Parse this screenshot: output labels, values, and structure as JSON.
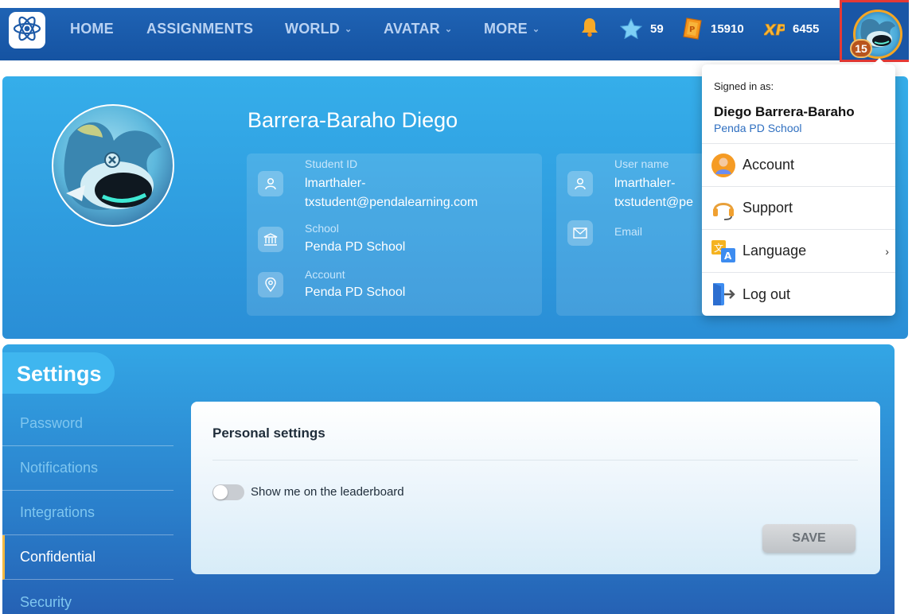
{
  "nav": {
    "items": [
      {
        "label": "HOME"
      },
      {
        "label": "ASSIGNMENTS"
      },
      {
        "label": "WORLD"
      },
      {
        "label": "AVATAR"
      },
      {
        "label": "MORE"
      }
    ],
    "stats": {
      "stars": "59",
      "coins": "15910",
      "xp": "6455"
    },
    "avatar_level": "15"
  },
  "profile": {
    "name": "Barrera-Baraho Diego",
    "student_id_label": "Student ID",
    "student_id_value_1": "lmarthaler-",
    "student_id_value_2": "txstudent@pendalearning.com",
    "school_label": "School",
    "school_value": "Penda PD School",
    "account_label": "Account",
    "account_value": "Penda PD School",
    "username_label": "User name",
    "username_value_1": "lmarthaler-",
    "username_value_2": "txstudent@pe",
    "email_label": "Email"
  },
  "settings": {
    "title": "Settings",
    "menu": [
      {
        "label": "Password"
      },
      {
        "label": "Notifications"
      },
      {
        "label": "Integrations"
      },
      {
        "label": "Confidential"
      },
      {
        "label": "Security"
      }
    ],
    "active": "Confidential",
    "panel": {
      "title": "Personal settings",
      "toggle_label": "Show me on the leaderboard",
      "toggle_on": false,
      "save_label": "SAVE"
    }
  },
  "dropdown": {
    "signed_in_label": "Signed in as:",
    "user_name": "Diego Barrera-Baraho",
    "school": "Penda PD School",
    "items": [
      {
        "label": "Account",
        "icon": "account-icon"
      },
      {
        "label": "Support",
        "icon": "headset-icon"
      },
      {
        "label": "Language",
        "icon": "translate-icon",
        "arrow": "›"
      },
      {
        "label": "Log out",
        "icon": "logout-icon"
      }
    ]
  },
  "colors": {
    "nav_bg": "#1a56a6",
    "profile_bg": "#35aeea",
    "active_accent": "#f5b942",
    "highlight_border": "#e53935"
  }
}
